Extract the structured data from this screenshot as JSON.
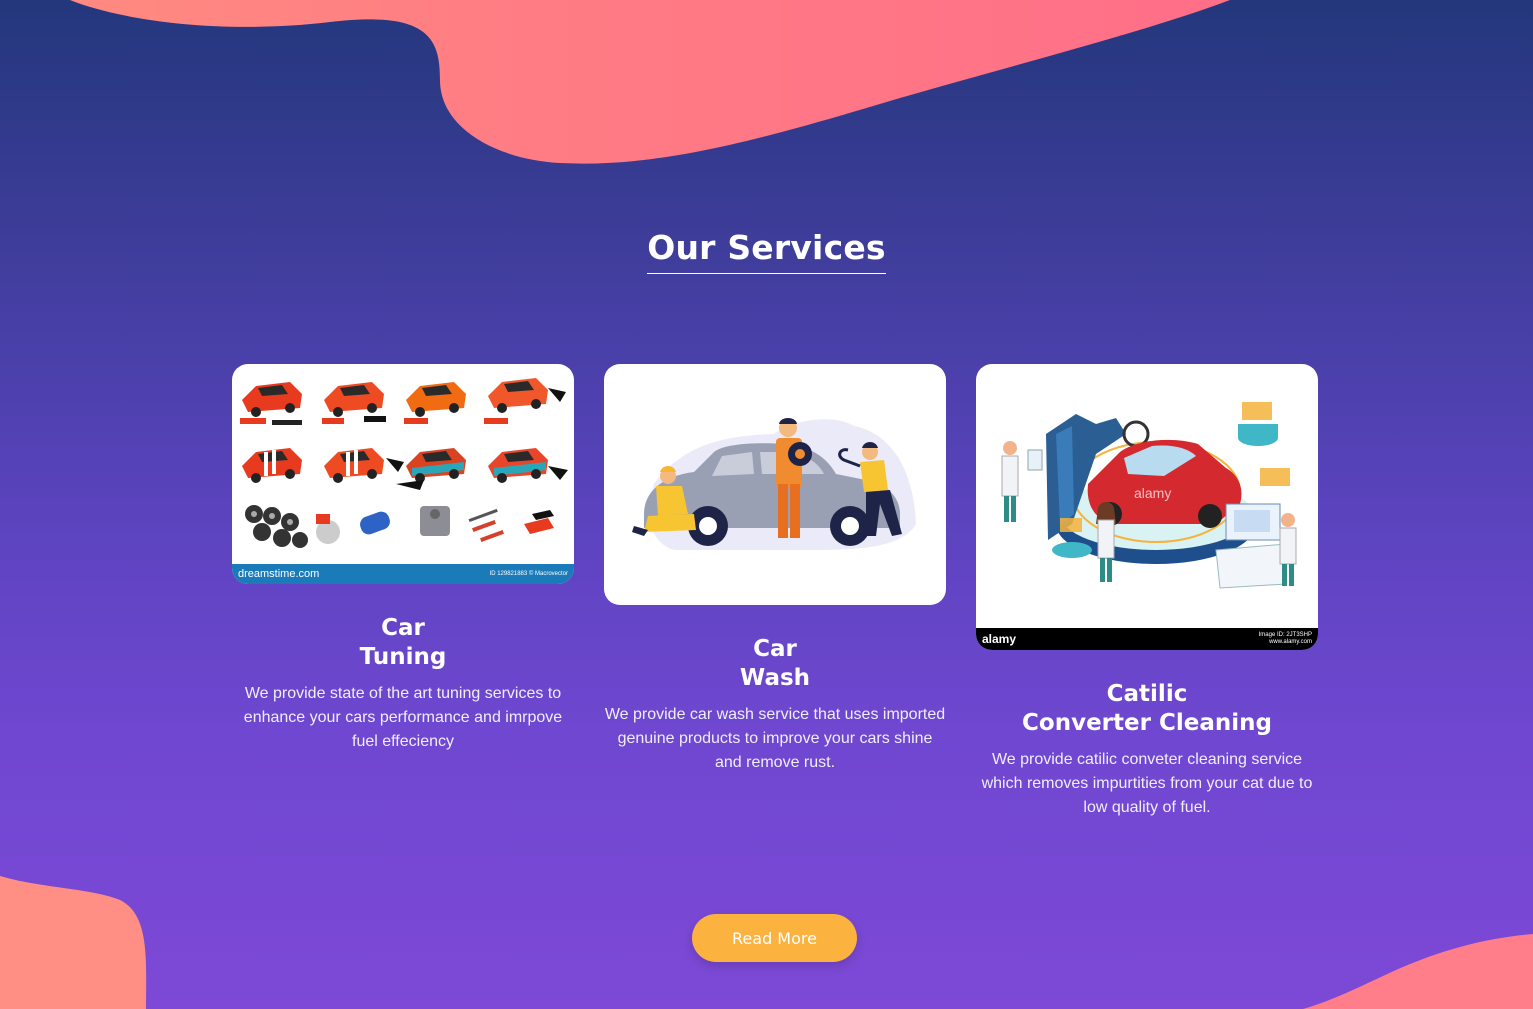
{
  "section": {
    "title": "Our Services"
  },
  "services": [
    {
      "title_line1": "Car",
      "title_line2": "Tuning",
      "description": "We provide state of the art tuning services to enhance your cars performance and imrpove fuel effeciency",
      "watermark": "dreamstime.com",
      "watermark_id": "ID 129821883 © Macrovector"
    },
    {
      "title_line1": "Car",
      "title_line2": "Wash",
      "description": "We provide car wash service that uses imported genuine products to improve your cars shine and remove rust."
    },
    {
      "title_line1": "Catilic",
      "title_line2": "Converter Cleaning",
      "description": "We provide catilic conveter cleaning service which removes impurtities from your cat due to low quality of fuel.",
      "watermark": "alamy",
      "watermark_center": "alamy",
      "watermark_id": "Image ID: 2JT3SHP",
      "watermark_url": "www.alamy.com"
    }
  ],
  "cta": {
    "label": "Read More"
  },
  "colors": {
    "blob": "#ff7a85",
    "button": "#fbb23f",
    "bg_top": "#23377c",
    "bg_bottom": "#7d49d6"
  }
}
